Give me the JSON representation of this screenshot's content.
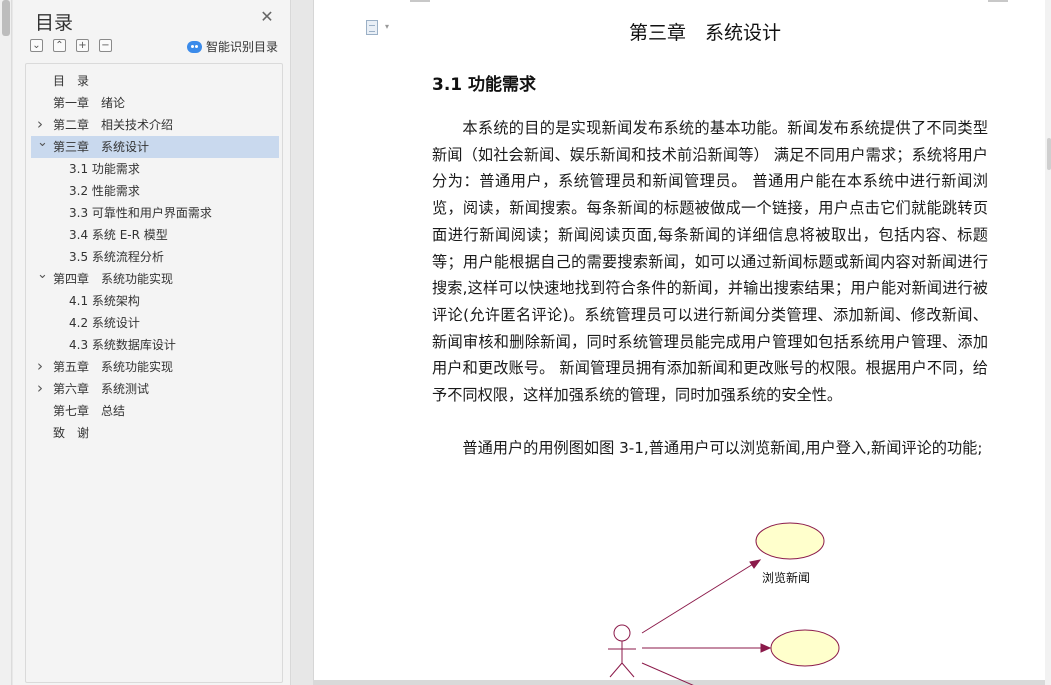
{
  "toc": {
    "title": "目录",
    "close_icon": "close-icon",
    "tools": [
      "collapse-all-icon",
      "expand-all-icon",
      "add-icon",
      "remove-icon"
    ],
    "smart_label": "智能识别目录",
    "items": [
      {
        "label": "目　录",
        "level": 0,
        "chevron": ""
      },
      {
        "label": "第一章　绪论",
        "level": 0,
        "chevron": ""
      },
      {
        "label": "第二章　相关技术介绍",
        "level": 0,
        "chevron": ">"
      },
      {
        "label": "第三章　系统设计",
        "level": 0,
        "chevron": "v",
        "selected": true
      },
      {
        "label": "3.1 功能需求",
        "level": 1,
        "chevron": ""
      },
      {
        "label": "3.2 性能需求",
        "level": 1,
        "chevron": ""
      },
      {
        "label": "3.3 可靠性和用户界面需求",
        "level": 1,
        "chevron": ""
      },
      {
        "label": "3.4 系统 E-R 模型",
        "level": 1,
        "chevron": ""
      },
      {
        "label": "3.5 系统流程分析",
        "level": 1,
        "chevron": ""
      },
      {
        "label": "第四章　系统功能实现",
        "level": 0,
        "chevron": "v"
      },
      {
        "label": "4.1 系统架构",
        "level": 1,
        "chevron": ""
      },
      {
        "label": "4.2 系统设计",
        "level": 1,
        "chevron": ""
      },
      {
        "label": "4.3 系统数据库设计",
        "level": 1,
        "chevron": ""
      },
      {
        "label": "第五章　系统功能实现",
        "level": 0,
        "chevron": ">"
      },
      {
        "label": "第六章　系统测试",
        "level": 0,
        "chevron": ">"
      },
      {
        "label": "第七章　总结",
        "level": 0,
        "chevron": ""
      },
      {
        "label": "致　谢",
        "level": 0,
        "chevron": ""
      }
    ]
  },
  "document": {
    "chapter_title": "第三章　系统设计",
    "section_title": "3.1 功能需求",
    "paragraph1": "本系统的目的是实现新闻发布系统的基本功能。新闻发布系统提供了不同类型新闻（如社会新闻、娱乐新闻和技术前沿新闻等） 满足不同用户需求；系统将用户分为：普通用户，系统管理员和新闻管理员。 普通用户能在本系统中进行新闻浏览，阅读，新闻搜索。每条新闻的标题被做成一个链接，用户点击它们就能跳转页面进行新闻阅读；新闻阅读页面,每条新闻的详细信息将被取出，包括内容、标题等；用户能根据自己的需要搜索新闻，如可以通过新闻标题或新闻内容对新闻进行搜索,这样可以快速地找到符合条件的新闻，并输出搜索结果；用户能对新闻进行被评论(允许匿名评论)。系统管理员可以进行新闻分类管理、添加新闻、修改新闻、新闻审核和删除新闻，同时系统管理员能完成用户管理如包括系统用户管理、添加用户和更改账号。 新闻管理员拥有添加新闻和更改账号的权限。根据用户不同，给予不同权限，这样加强系统的管理，同时加强系统的安全性。",
    "paragraph2": "普通用户的用例图如图 3-1,普通用户可以浏览新闻,用户登入,新闻评论的功能;",
    "doc_icon": "document-icon",
    "diagram": {
      "use_cases": [
        "浏览新闻"
      ],
      "colors": {
        "ellipse_fill": "#ffffcc",
        "line": "#8b1a4a"
      }
    }
  }
}
